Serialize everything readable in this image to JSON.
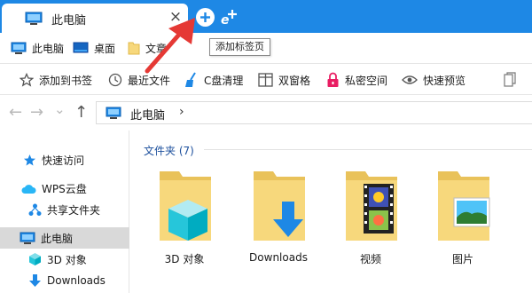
{
  "tabbar": {
    "tab_title": "此电脑",
    "close_glyph": "×",
    "new_tab_icon": "plus-circle-icon",
    "ie_tab_icon": "ie-plus-icon",
    "tooltip": "添加标签页"
  },
  "bookmarks": [
    {
      "label": "此电脑",
      "icon": "computer-icon"
    },
    {
      "label": "桌面",
      "icon": "desktop-icon"
    },
    {
      "label": "文章",
      "icon": "folder-icon"
    }
  ],
  "toolbar": {
    "items": [
      {
        "label": "添加到书签",
        "icon": "star-icon"
      },
      {
        "label": "最近文件",
        "icon": "clock-icon"
      },
      {
        "label": "C盘清理",
        "icon": "broom-icon"
      },
      {
        "label": "双窗格",
        "icon": "dual-pane-icon"
      },
      {
        "label": "私密空间",
        "icon": "lock-icon"
      },
      {
        "label": "快速预览",
        "icon": "eye-icon"
      }
    ]
  },
  "address": {
    "back": "←",
    "forward": "→",
    "dropdown": "⌄",
    "up": "↑",
    "path": "此电脑",
    "chevron": "›"
  },
  "navpane": {
    "items": [
      {
        "label": "快速访问",
        "icon": "star-icon"
      },
      {
        "label": "WPS云盘",
        "icon": "cloud-icon"
      },
      {
        "label": "共享文件夹",
        "icon": "share-icon"
      },
      {
        "label": "此电脑",
        "icon": "computer-icon",
        "selected": true
      },
      {
        "label": "3D 对象",
        "icon": "cube-icon"
      },
      {
        "label": "Downloads",
        "icon": "download-icon"
      }
    ]
  },
  "content": {
    "group_header": "文件夹 (7)",
    "folders": [
      {
        "name": "3D 对象",
        "overlay": "cube"
      },
      {
        "name": "Downloads",
        "overlay": "download"
      },
      {
        "name": "视频",
        "overlay": "film"
      },
      {
        "name": "图片",
        "overlay": "picture"
      }
    ]
  },
  "colors": {
    "accent": "#1e88e5",
    "folder": "#f7d87c",
    "annotation": "#e53935",
    "group_header": "#1c4f9c"
  }
}
